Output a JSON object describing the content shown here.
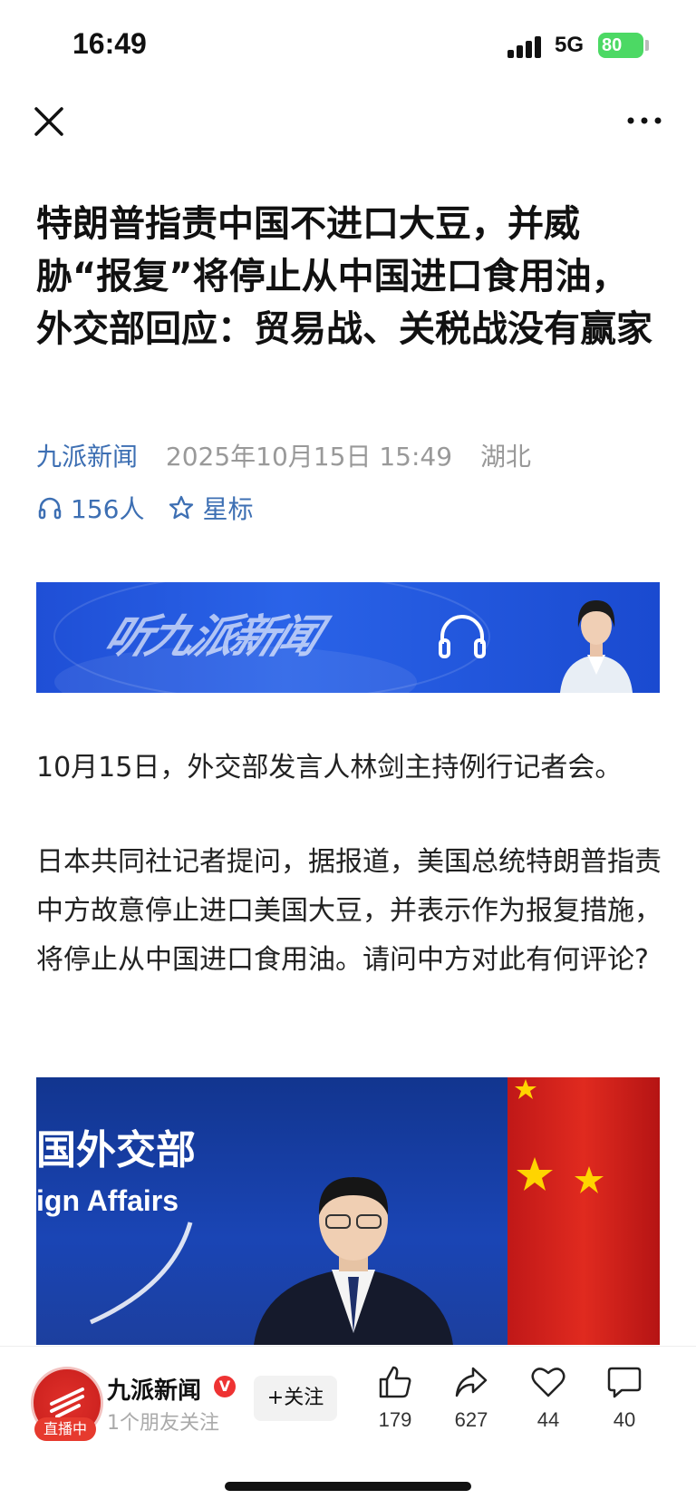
{
  "status_bar": {
    "time": "16:49",
    "network": "5G",
    "battery": "80"
  },
  "nav": {
    "close_icon": "close-icon",
    "more_icon": "more-icon"
  },
  "article": {
    "title": "特朗普指责中国不进口大豆，并威胁“报复”将停止从中国进口食用油，外交部回应：贸易战、关税战没有赢家",
    "source": "九派新闻",
    "date": "2025年10月15日 15:49",
    "location": "湖北",
    "listen_count": "156人",
    "star_label": "星标",
    "banner_text": "听九派新闻",
    "paragraph_1": "10月15日，外交部发言人林剑主持例行记者会。",
    "paragraph_2": "日本共同社记者提问，据报道，美国总统特朗普指责中方故意停止进口美国大豆，并表示作为报复措施，将停止从中国进口食用油。请问中方对此有何评论?",
    "photo_text_cn": "国外交部",
    "photo_text_en": "ign Affairs"
  },
  "bottom_bar": {
    "account_name": "九派新闻",
    "verified_mark": "V",
    "live_badge": "直播中",
    "friends_following": "1个朋友关注",
    "follow_label": "+关注",
    "like_count": "179",
    "share_count": "627",
    "favorite_count": "44",
    "comment_count": "40"
  },
  "colors": {
    "accent_blue": "#3d6fb3",
    "battery_green": "#4cd964",
    "live_red": "#e63a2e"
  }
}
